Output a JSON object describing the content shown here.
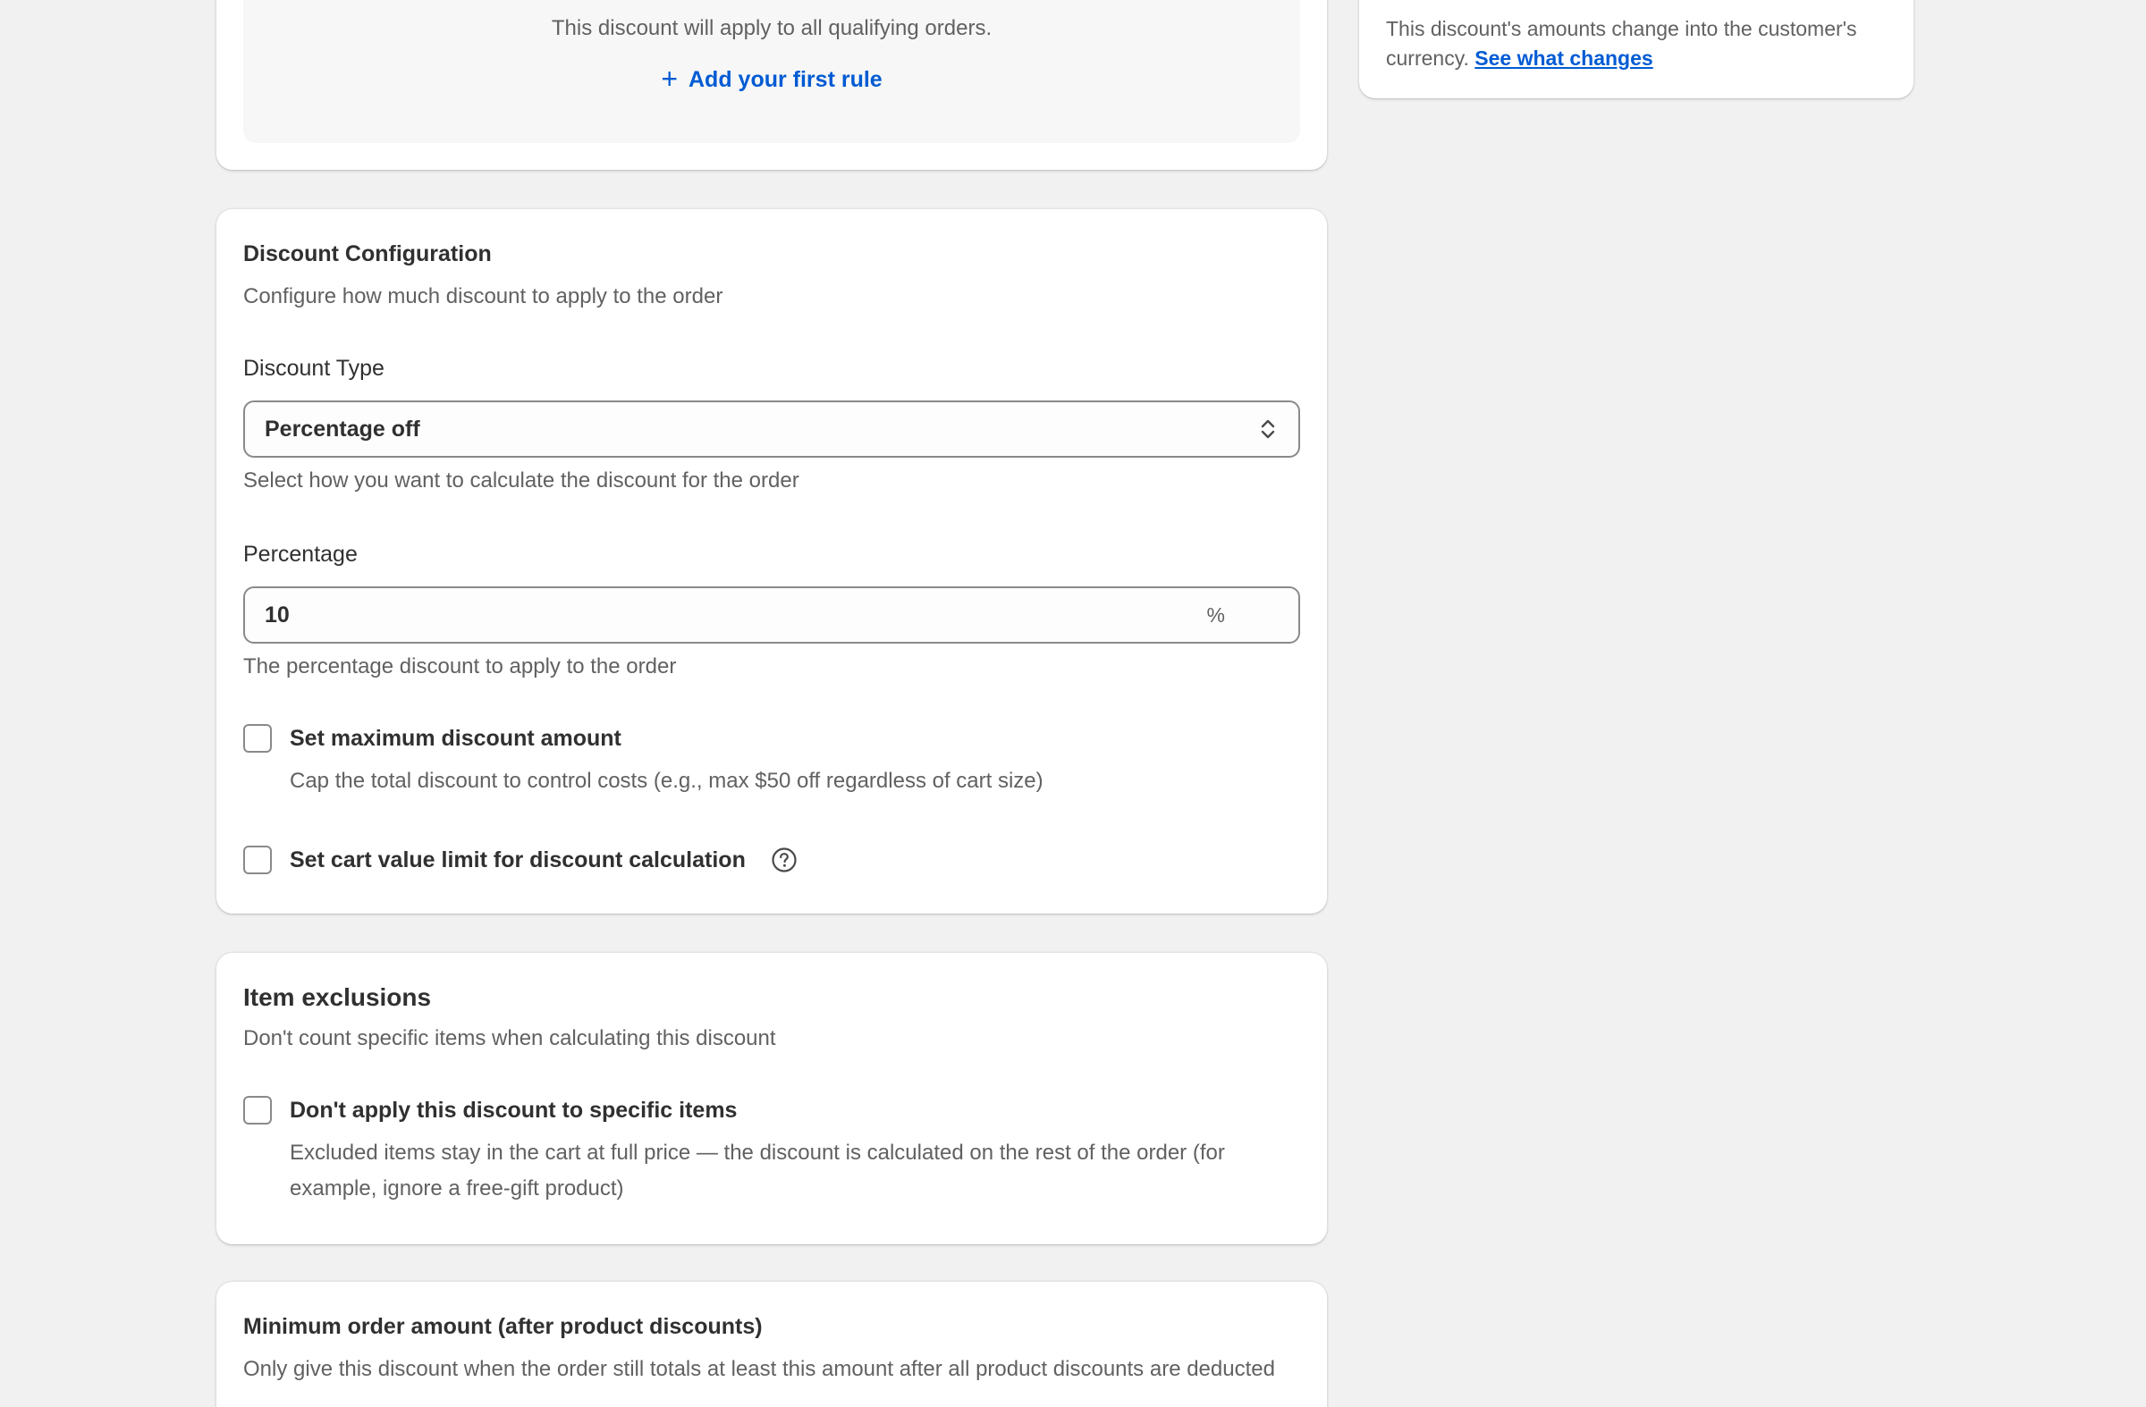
{
  "rules_card": {
    "empty_text": "This discount will apply to all qualifying orders.",
    "add_rule_label": "Add your first rule"
  },
  "side_card": {
    "text": "This discount's amounts change into the customer's currency.",
    "link_label": "See what changes"
  },
  "discount_configuration": {
    "title": "Discount Configuration",
    "description": "Configure how much discount to apply to the order",
    "discount_type": {
      "label": "Discount Type",
      "selected": "Percentage off",
      "help": "Select how you want to calculate the discount for the order"
    },
    "percentage": {
      "label": "Percentage",
      "value": "10",
      "suffix": "%",
      "help": "The percentage discount to apply to the order"
    },
    "max_discount": {
      "label": "Set maximum discount amount",
      "checked": false,
      "help": "Cap the total discount to control costs (e.g., max $50 off regardless of cart size)"
    },
    "cart_limit": {
      "label": "Set cart value limit for discount calculation",
      "checked": false
    }
  },
  "item_exclusions": {
    "title": "Item exclusions",
    "description": "Don't count specific items when calculating this discount",
    "exclude_items": {
      "label": "Don't apply this discount to specific items",
      "checked": false,
      "help": "Excluded items stay in the cart at full price — the discount is calculated on the rest of the order (for example, ignore a free-gift product)"
    }
  },
  "minimum_order": {
    "title": "Minimum order amount (after product discounts)",
    "description": "Only give this discount when the order still totals at least this amount after all product discounts are deducted"
  },
  "colors": {
    "background": "#f1f1f1",
    "card": "#ffffff",
    "link": "#005bd3",
    "text": "#303030",
    "subdued_text": "#616161"
  }
}
